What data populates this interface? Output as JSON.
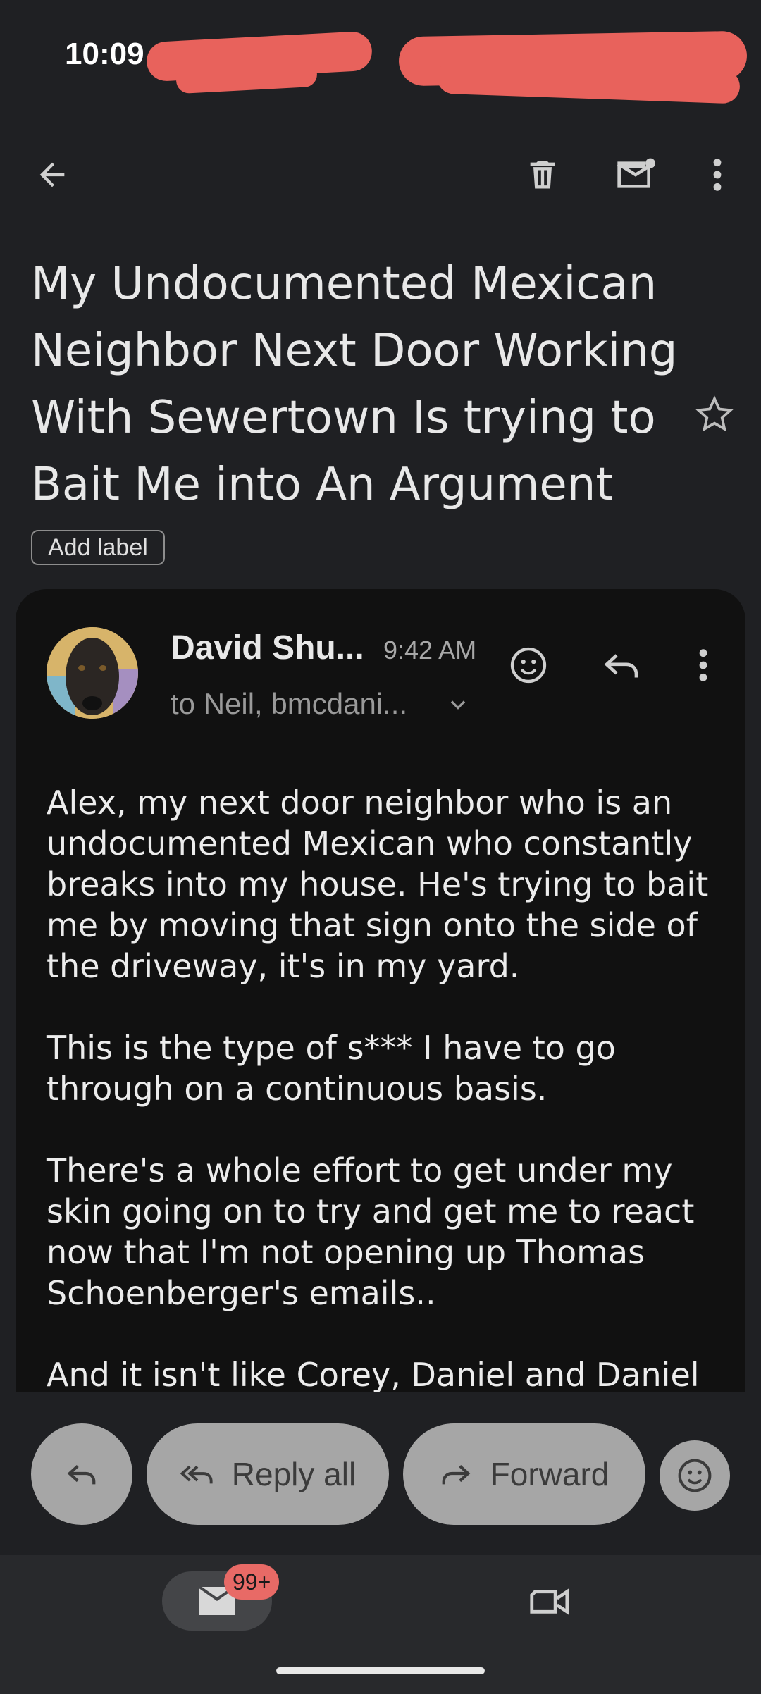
{
  "status_bar": {
    "time": "10:09"
  },
  "toolbar": {
    "back_icon": "arrow-back-icon",
    "delete_icon": "trash-icon",
    "mark_unread_icon": "mail-unread-icon",
    "more_icon": "more-vert-icon"
  },
  "email": {
    "subject": "My Undocumented Mexican Neighbor Next Door Working With Sewertown Is trying to Bait Me into An Argument",
    "add_label": "Add label",
    "sender": "David Shu...",
    "time": "9:42 AM",
    "recipients": "to Neil, bmcdani...",
    "body": "Alex, my next door neighbor who is an undocumented Mexican who constantly breaks into my house. He's trying to bait me by moving that sign onto the side of the driveway, it's in my yard.\n\nThis is the type of s*** I have to go through on a continuous basis.\n\nThere's a whole effort to get under my skin going on to try and get me to react now that I'm not opening up Thomas Schoenberger's emails..\n\nAnd it isn't like Corey, Daniel and Daniel"
  },
  "actions": {
    "reply_all": "Reply all",
    "forward": "Forward"
  },
  "nav": {
    "mail_badge": "99+",
    "video_icon": "video-camera-icon"
  },
  "colors": {
    "background": "#1f2023",
    "card": "#111111",
    "pill": "#a6a6a6",
    "badge": "#e86a66",
    "redaction": "#e8625c"
  }
}
